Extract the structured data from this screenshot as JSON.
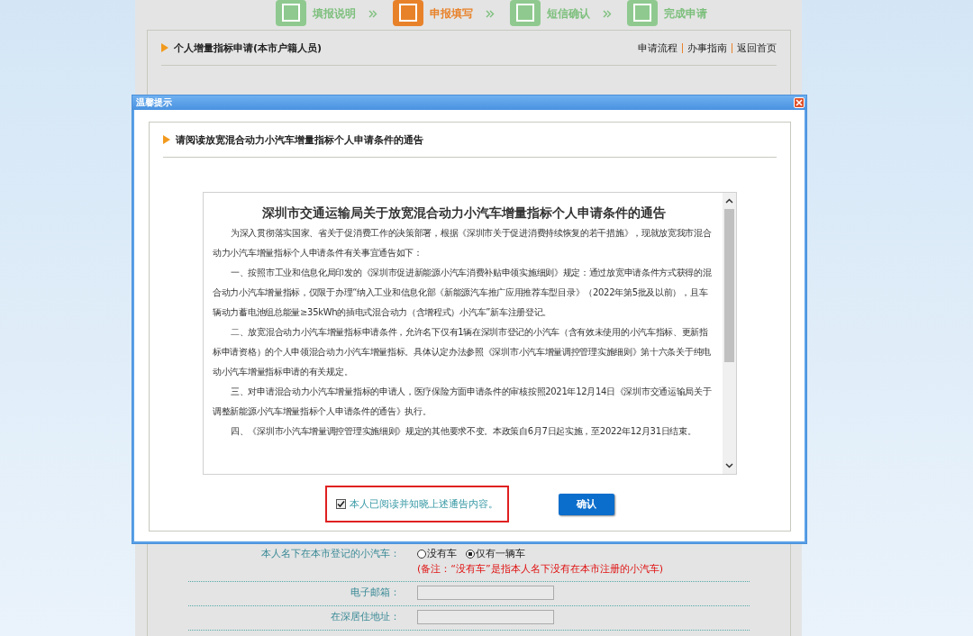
{
  "steps": [
    {
      "label": "填报说明",
      "selected": false
    },
    {
      "label": "申报填写",
      "selected": true
    },
    {
      "label": "短信确认",
      "selected": false
    },
    {
      "label": "完成申请",
      "selected": false
    }
  ],
  "panel": {
    "title": "个人增量指标申请(本市户籍人员)",
    "links": [
      "申请流程",
      "办事指南",
      "返回首页"
    ]
  },
  "form": [
    {
      "kind": "radio",
      "label": "本人名下在本市登记的小汽车：",
      "options": [
        {
          "label": "没有车",
          "selected": false
        },
        {
          "label": "仅有一辆车",
          "selected": true
        }
      ],
      "note": "(备注：“没有车”是指本人名下没有在本市注册的小汽车)"
    },
    {
      "kind": "input",
      "label": "电子邮箱："
    },
    {
      "kind": "input",
      "label": "在深居住地址："
    }
  ],
  "dialog": {
    "title": "温馨提示",
    "heading": "请阅读放宽混合动力小汽车增量指标个人申请条件的通告",
    "notice_title": "深圳市交通运输局关于放宽混合动力小汽车增量指标个人申请条件的通告",
    "paragraphs": [
      "为深入贯彻落实国家、省关于促消费工作的决策部署，根据《深圳市关于促进消费持续恢复的若干措施》，现就放宽我市混合动力小汽车增量指标个人申请条件有关事宜通告如下：",
      "一、按照市工业和信息化局印发的《深圳市促进新能源小汽车消费补贴申领实施细则》规定：通过放宽申请条件方式获得的混合动力小汽车增量指标，仅限于办理“纳入工业和信息化部《新能源汽车推广应用推荐车型目录》（2022年第5批及以前），且车辆动力蓄电池组总能量≥35kWh的插电式混合动力（含增程式）小汽车”新车注册登记。",
      "二、放宽混合动力小汽车增量指标申请条件，允许名下仅有1辆在深圳市登记的小汽车（含有效未使用的小汽车指标、更新指标申请资格）的个人申领混合动力小汽车增量指标。具体认定办法参照《深圳市小汽车增量调控管理实施细则》第十六条关于纯电动小汽车增量指标申请的有关规定。",
      "三、对申请混合动力小汽车增量指标的申请人，医疗保险方面申请条件的审核按照2021年12月14日《深圳市交通运输局关于调整新能源小汽车增量指标个人申请条件的通告》执行。",
      "四、《深圳市小汽车增量调控管理实施细则》规定的其他要求不变。本政策自6月7日起实施，至2022年12月31日结束。"
    ],
    "agree": {
      "label": "本人已阅读并知晓上述通告内容。",
      "checked": true
    },
    "confirm": "确认"
  }
}
